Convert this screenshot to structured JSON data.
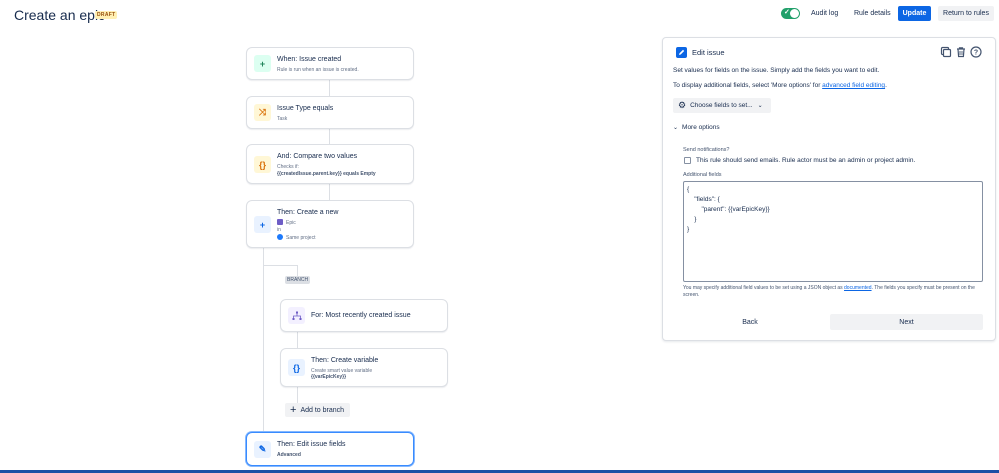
{
  "header": {
    "title": "Create an epic",
    "status_badge": "DRAFT",
    "audit_log": "Audit log",
    "rule_details": "Rule details",
    "update": "Update",
    "return_to_rules": "Return to rules",
    "rule_enabled": true
  },
  "flow": {
    "trigger": {
      "title": "When: Issue created",
      "subtitle": "Rule is run when an issue is created."
    },
    "condition_type": {
      "title": "Issue Type equals",
      "subtitle": "Task"
    },
    "condition_compare": {
      "title": "And: Compare two values",
      "subtitle": "Checks if:",
      "detail": "{{createdIssue.parent.key}} equals Empty"
    },
    "create_new": {
      "title": "Then: Create a new",
      "type": "Epic",
      "in": "in",
      "project": "Same project"
    },
    "branch_tag": "BRANCH",
    "branch_for": {
      "title": "For: Most recently created issue"
    },
    "create_variable": {
      "title": "Then: Create variable",
      "subtitle": "Create smart value variable",
      "detail": "{{varEpicKey}}"
    },
    "add_to_branch": "Add to branch",
    "edit_fields": {
      "title": "Then: Edit issue fields",
      "detail": "Advanced"
    }
  },
  "panel": {
    "title": "Edit issue",
    "desc1": "Set values for fields on the issue. Simply add the fields you want to edit.",
    "desc2_prefix": "To display additional fields, select 'More options' for ",
    "desc2_link": "advanced field editing",
    "desc2_suffix": ".",
    "choose_fields": "Choose fields to set...",
    "more_options": "More options",
    "send_notifications_label": "Send notifications?",
    "send_notifications_text": "This rule should send emails. Rule actor must be an admin or project admin.",
    "additional_fields_label": "Additional fields",
    "json_value": "{\n    \"fields\": {\n        \"parent\": {{varEpicKey}}\n    }\n}",
    "helper_prefix": "You may specify additional field values to be set using a JSON object as ",
    "helper_link": "documented",
    "helper_suffix": ". The fields you specify must be present on the screen.",
    "back": "Back",
    "next": "Next"
  },
  "colors": {
    "accent": "#0c66e4",
    "toggle_on": "#22a06b",
    "draft_bg": "#fff0b3",
    "selected_border": "#388bff"
  },
  "icons": {
    "trigger": "plus-icon",
    "condition_type": "shuffle-icon",
    "condition_compare": "braces-icon",
    "create_new": "plus-icon",
    "branch": "hierarchy-icon",
    "variable": "braces-icon",
    "edit": "pencil-icon"
  }
}
